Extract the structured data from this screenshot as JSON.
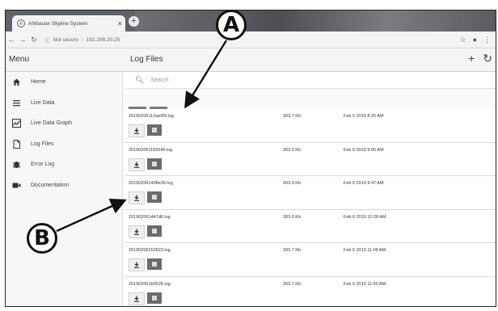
{
  "browser": {
    "tab_title": "Ahlbasier Skyline System",
    "new_tab": "+",
    "not_secure": "Not secure",
    "url": "192.168.20.25"
  },
  "app": {
    "menu_title": "Menu",
    "page_title": "Log Files",
    "search_placeholder": "Search"
  },
  "sidebar": {
    "items": [
      {
        "label": "Home",
        "icon": "home-icon"
      },
      {
        "label": "Live Data",
        "icon": "list-icon"
      },
      {
        "label": "Live Data Graph",
        "icon": "graph-icon"
      },
      {
        "label": "Log Files",
        "icon": "file-icon"
      },
      {
        "label": "Error Log",
        "icon": "bug-icon"
      },
      {
        "label": "Documentation",
        "icon": "video-icon"
      }
    ]
  },
  "files": [
    {
      "name": "20190206112ae5f9.log",
      "size": "303.7 Kb",
      "date": "Feb 6 2019 8:25 AM"
    },
    {
      "name": "201902061182046.log",
      "size": "303.0 Kb",
      "date": "Feb 6 2019 9:05 AM"
    },
    {
      "name": "201902061408e36.log",
      "size": "303.9 Kb",
      "date": "Feb 6 2019 9:47 AM"
    },
    {
      "name": "201902061447d6.log",
      "size": "303.0 Kb",
      "date": "Feb 6 2019 10:28 AM"
    },
    {
      "name": "20190206152823.log",
      "size": "303.7 Kb",
      "date": "Feb 6 2019 11:09 AM"
    },
    {
      "name": "201902061b0528.log",
      "size": "303.7 Kb",
      "date": "Feb 6 2019 11:50 AM"
    }
  ],
  "callouts": {
    "a": "A",
    "b": "B"
  }
}
